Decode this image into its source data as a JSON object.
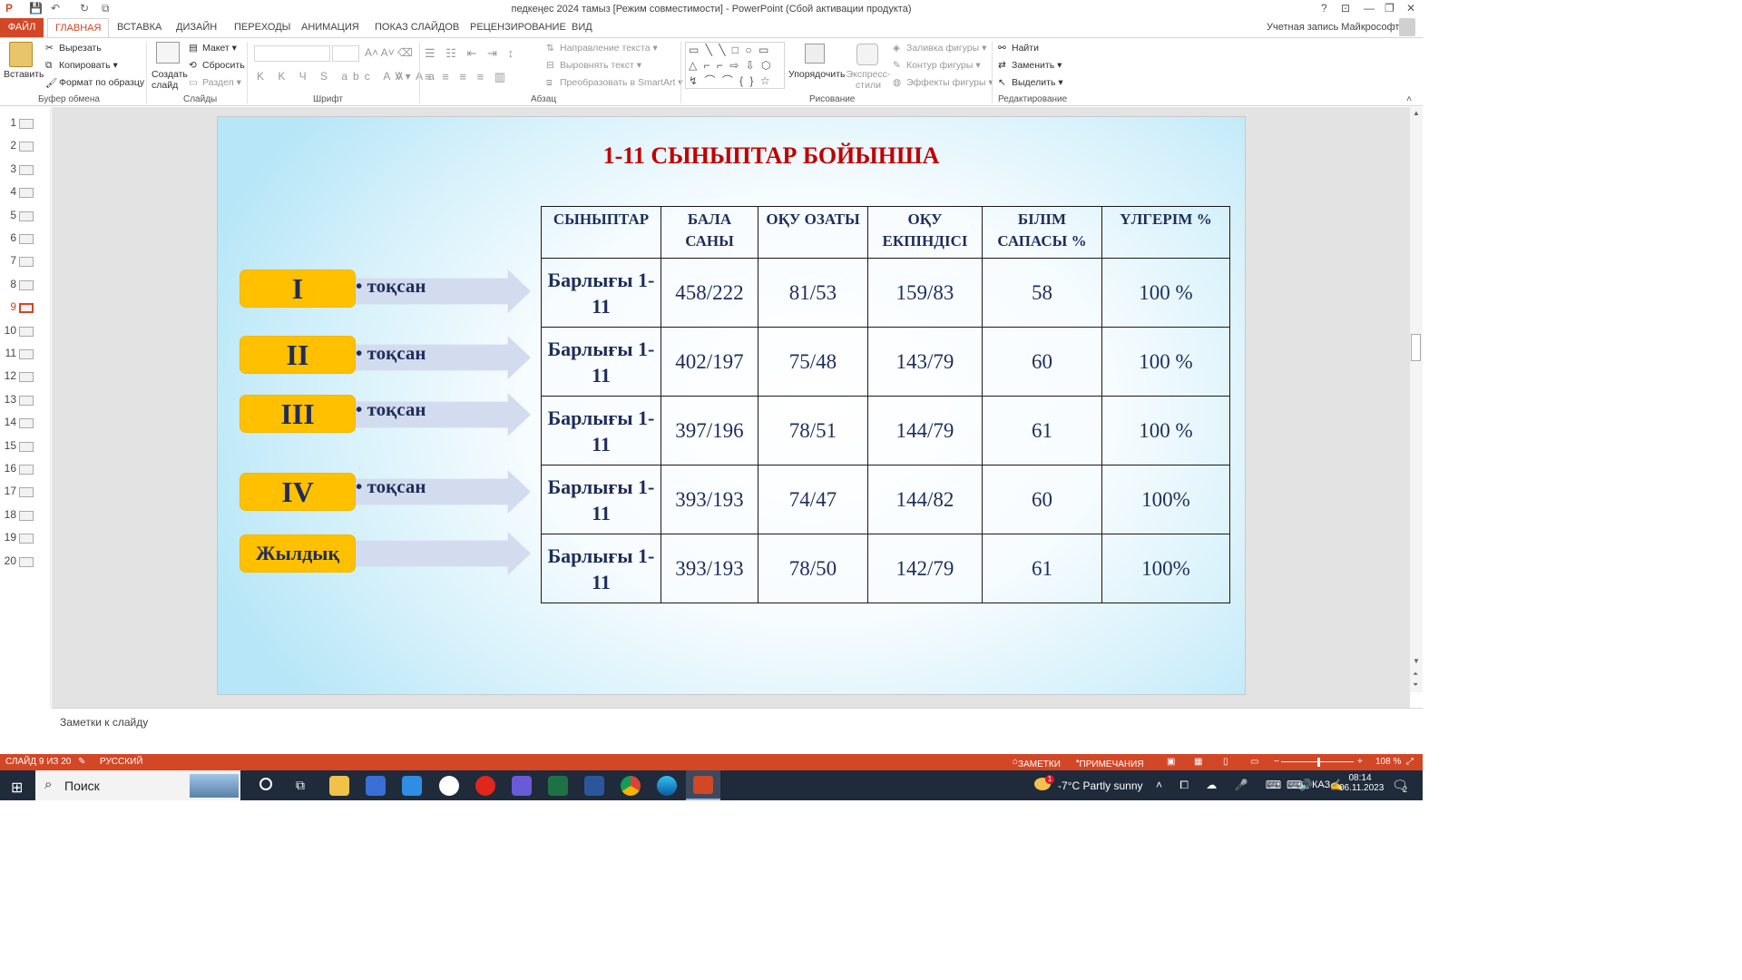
{
  "window": {
    "title": "педкеңес 2024 тамыз [Режим совместимости] - PowerPoint (Сбой активации продукта)",
    "help": "?",
    "minimize": "—",
    "restore": "❐",
    "close": "✕",
    "account": "Учетная запись Майкрософт"
  },
  "tabs": [
    "ФАЙЛ",
    "ГЛАВНАЯ",
    "ВСТАВКА",
    "ДИЗАЙН",
    "ПЕРЕХОДЫ",
    "АНИМАЦИЯ",
    "ПОКАЗ СЛАЙДОВ",
    "РЕЦЕНЗИРОВАНИЕ",
    "ВИД"
  ],
  "ribbon": {
    "clipboard": {
      "paste": "Вставить",
      "cut": "Вырезать",
      "copy": "Копировать",
      "format_painter": "Формат по образцу",
      "label": "Буфер обмена"
    },
    "slides": {
      "new_slide": "Создать слайд",
      "layout": "Макет",
      "reset": "Сбросить",
      "section": "Раздел",
      "label": "Слайды"
    },
    "font": {
      "label": "Шрифт"
    },
    "paragraph": {
      "text_direction": "Направление текста",
      "align_text": "Выровнять текст",
      "smartart": "Преобразовать в SmartArt",
      "label": "Абзац"
    },
    "drawing": {
      "arrange": "Упорядочить",
      "quick_styles": "Экспресс-стили",
      "fill": "Заливка фигуры",
      "outline": "Контур фигуры",
      "effects": "Эффекты фигуры",
      "label": "Рисование"
    },
    "editing": {
      "find": "Найти",
      "replace": "Заменить",
      "select": "Выделить",
      "label": "Редактирование"
    }
  },
  "thumbnails": {
    "count": 20,
    "selected": 9
  },
  "slide": {
    "title": "1-11 СЫНЫПТАР БОЙЫНША",
    "quarters": [
      {
        "label": "I",
        "text": "•  тоқсан"
      },
      {
        "label": "II",
        "text": "•  тоқсан"
      },
      {
        "label": "III",
        "text": "•  тоқсан"
      },
      {
        "label": "IV",
        "text": "•  тоқсан"
      },
      {
        "label": "Жылдық",
        "text": ""
      }
    ],
    "table": {
      "headers": [
        "СЫНЫПТАР",
        "БАЛА САНЫ",
        "ОҚУ ОЗАТЫ",
        "ОҚУ ЕКПІНДІСІ",
        "БІЛІМ САПАСЫ  %",
        "ҮЛГЕРІМ %"
      ],
      "rows": [
        [
          "Барлығы 1-11",
          "458/222",
          "81/53",
          "159/83",
          "58",
          "100 %"
        ],
        [
          "Барлығы 1-11",
          "402/197",
          "75/48",
          "143/79",
          "60",
          "100 %"
        ],
        [
          "Барлығы 1-11",
          "397/196",
          "78/51",
          "144/79",
          "61",
          "100 %"
        ],
        [
          "Барлығы 1-11",
          "393/193",
          "74/47",
          "144/82",
          "60",
          "100%"
        ],
        [
          "Барлығы 1-11",
          "393/193",
          "78/50",
          "142/79",
          "61",
          "100%"
        ]
      ]
    }
  },
  "notes_placeholder": "Заметки к слайду",
  "status": {
    "slide_info": "СЛАЙД 9 ИЗ 20",
    "language": "РУССКИЙ",
    "notes": "ЗАМЕТКИ",
    "comments": "ПРИМЕЧАНИЯ",
    "zoom": "108 %"
  },
  "taskbar": {
    "search": "Поиск",
    "weather": "-7°C  Partly sunny",
    "weather_badge": "1",
    "lang": "КАЗ",
    "time": "08:14",
    "date": "06.11.2023",
    "notif_count": "2"
  },
  "colors": {
    "accent": "#d24726",
    "slide_title": "#c00000",
    "quarter_box": "#ffc000",
    "arrow": "#d3dcef",
    "table_text": "#1f2d5a"
  }
}
